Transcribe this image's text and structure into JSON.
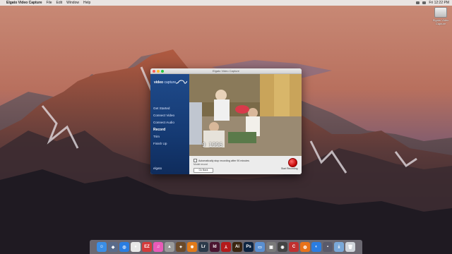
{
  "menubar": {
    "apple": "",
    "app_name": "Elgato Video Capture",
    "items": [
      "File",
      "Edit",
      "Window",
      "Help"
    ],
    "right_items": [
      "Fri 12:22 PM"
    ]
  },
  "desktop": {
    "drive_label": "Elgato Video Capture"
  },
  "window": {
    "title": "Elgato Video Capture",
    "brand_bold": "video",
    "brand_thin": "capture",
    "nav": [
      {
        "label": "Get Started",
        "active": false
      },
      {
        "label": "Connect Video",
        "active": false
      },
      {
        "label": "Connect Audio",
        "active": false
      },
      {
        "label": "Record",
        "active": true
      },
      {
        "label": "Trim",
        "active": false
      },
      {
        "label": "Finish Up",
        "active": false
      }
    ],
    "footer_brand": "elgato",
    "timestamp": "9 1996",
    "auto_stop_label": "Automatically stop recording after 90 minutes",
    "hint": "Model record",
    "go_back_label": "Go Back",
    "record_label": "Start Recording"
  },
  "dock": {
    "icons": [
      {
        "name": "finder-icon",
        "color": "#3a8ee6",
        "glyph": "☺"
      },
      {
        "name": "launchpad-icon",
        "color": "#5a6b8a",
        "glyph": "◆"
      },
      {
        "name": "safari-icon",
        "color": "#2a7de1",
        "glyph": "◎"
      },
      {
        "name": "chrome-icon",
        "color": "#e8e8e8",
        "glyph": "●"
      },
      {
        "name": "ez-icon",
        "color": "#d23b3b",
        "glyph": "EZ"
      },
      {
        "name": "itunes-icon",
        "color": "#e85ab8",
        "glyph": "♫"
      },
      {
        "name": "app-icon",
        "color": "#9a9a9a",
        "glyph": "▲"
      },
      {
        "name": "movie-icon",
        "color": "#6a4a2a",
        "glyph": "✦"
      },
      {
        "name": "firefox-icon",
        "color": "#e07a1a",
        "glyph": "✹"
      },
      {
        "name": "lightroom-icon",
        "color": "#2b3a4a",
        "glyph": "Lr"
      },
      {
        "name": "indesign-icon",
        "color": "#4a1530",
        "glyph": "Id"
      },
      {
        "name": "acrobat-icon",
        "color": "#b31b1b",
        "glyph": "⅄"
      },
      {
        "name": "illustrator-icon",
        "color": "#3a2510",
        "glyph": "Ai"
      },
      {
        "name": "photoshop-icon",
        "color": "#0d2440",
        "glyph": "Ps"
      },
      {
        "name": "folder-icon",
        "color": "#5a8fd0",
        "glyph": "▭"
      },
      {
        "name": "preview-icon",
        "color": "#7a7a7a",
        "glyph": "▣"
      },
      {
        "name": "capture-icon",
        "color": "#444",
        "glyph": "◉"
      },
      {
        "name": "app-c-icon",
        "color": "#c03030",
        "glyph": "C"
      },
      {
        "name": "firefox2-icon",
        "color": "#e8721a",
        "glyph": "◍"
      },
      {
        "name": "browser-icon",
        "color": "#2a7de1",
        "glyph": "◐"
      },
      {
        "name": "app2-icon",
        "color": "#5a5a6a",
        "glyph": "▪"
      },
      {
        "name": "downloads-icon",
        "color": "#7aa8d8",
        "glyph": "⤓"
      },
      {
        "name": "trash-icon",
        "color": "#cfd4da",
        "glyph": "🗑"
      }
    ]
  }
}
